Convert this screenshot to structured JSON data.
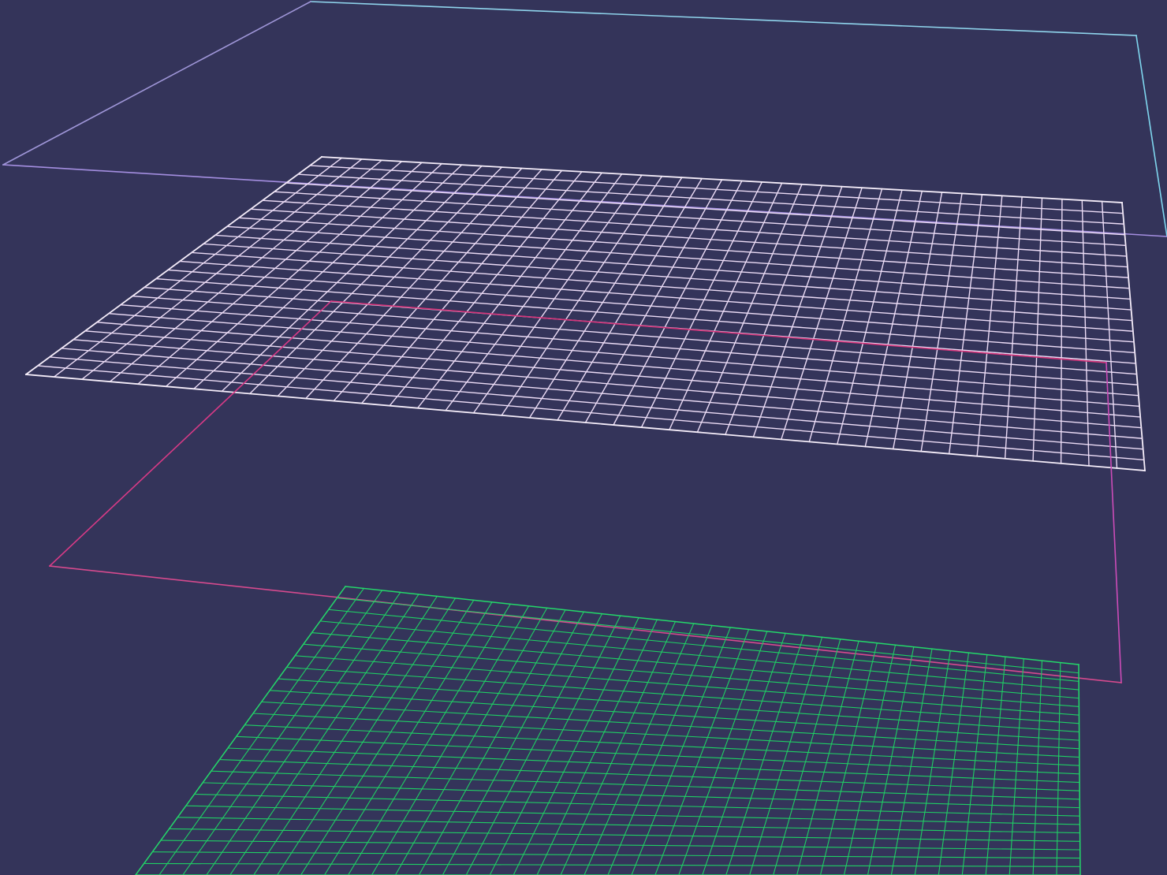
{
  "viewport": {
    "background_color": "#34345a"
  },
  "planes": [
    {
      "name": "top-outline-plane",
      "style": "outline",
      "colors": {
        "back": "#8fd4ec",
        "left": "#9f96d8",
        "front": "#a48ee0",
        "right": "#7fd6ee"
      },
      "subdivisions": 0
    },
    {
      "name": "white-grid-plane",
      "style": "grid",
      "colors": {
        "lines": "#ecdcf6",
        "border": "#f6eefa"
      },
      "subdivisions": 40
    },
    {
      "name": "magenta-outline-plane",
      "style": "outline",
      "colors": {
        "back": "#d6347a",
        "left": "#d83a86",
        "front": "#d64a8e",
        "right": "#cc4cb8"
      },
      "subdivisions": 0
    },
    {
      "name": "green-grid-plane",
      "style": "grid",
      "colors": {
        "lines": "#1fcf64",
        "border": "#24d86a"
      },
      "subdivisions": 40
    }
  ]
}
